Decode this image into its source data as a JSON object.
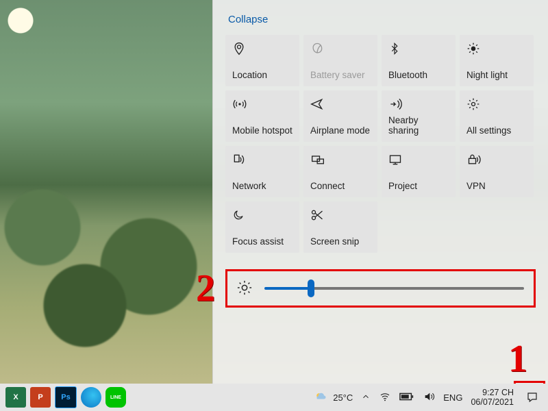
{
  "panel": {
    "collapse_label": "Collapse",
    "tiles": [
      {
        "id": "location",
        "label": "Location",
        "disabled": false
      },
      {
        "id": "battery-saver",
        "label": "Battery saver",
        "disabled": true
      },
      {
        "id": "bluetooth",
        "label": "Bluetooth",
        "disabled": false
      },
      {
        "id": "night-light",
        "label": "Night light",
        "disabled": false
      },
      {
        "id": "mobile-hotspot",
        "label": "Mobile hotspot",
        "disabled": false
      },
      {
        "id": "airplane-mode",
        "label": "Airplane mode",
        "disabled": false
      },
      {
        "id": "nearby-sharing",
        "label": "Nearby sharing",
        "disabled": false
      },
      {
        "id": "all-settings",
        "label": "All settings",
        "disabled": false
      },
      {
        "id": "network",
        "label": "Network",
        "disabled": false
      },
      {
        "id": "connect",
        "label": "Connect",
        "disabled": false
      },
      {
        "id": "project",
        "label": "Project",
        "disabled": false
      },
      {
        "id": "vpn",
        "label": "VPN",
        "disabled": false
      },
      {
        "id": "focus-assist",
        "label": "Focus assist",
        "disabled": false
      },
      {
        "id": "screen-snip",
        "label": "Screen snip",
        "disabled": false
      }
    ],
    "brightness_percent": 18
  },
  "taskbar": {
    "weather_temp": "25°C",
    "lang": "ENG",
    "time": "9:27 CH",
    "date": "06/07/2021",
    "apps": [
      {
        "id": "excel",
        "label": "X"
      },
      {
        "id": "powerpoint",
        "label": "P"
      },
      {
        "id": "photoshop",
        "label": "Ps"
      },
      {
        "id": "edge",
        "label": ""
      },
      {
        "id": "line",
        "label": "LINE"
      }
    ]
  },
  "annotations": {
    "step1": "1",
    "step2": "2"
  }
}
